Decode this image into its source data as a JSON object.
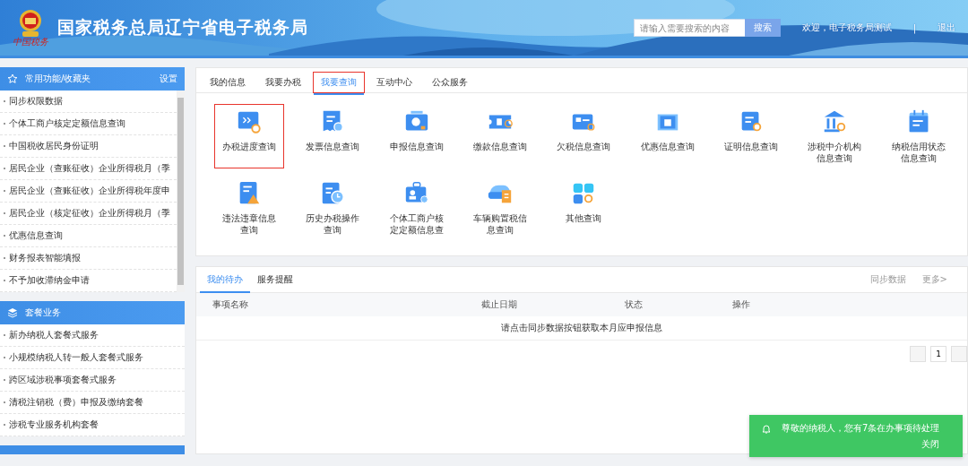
{
  "header": {
    "title": "国家税务总局辽宁省电子税务局",
    "logo_caption": "中国税务",
    "search": {
      "placeholder": "请输入需要搜索的内容",
      "button": "搜索"
    },
    "welcome": "欢迎，电子税务局测试",
    "separator": "|",
    "logout": "退出"
  },
  "sidebar": {
    "sections": [
      {
        "title": "常用功能/收藏夹",
        "action": "设置",
        "items": [
          "同步权限数据",
          "个体工商户核定定额信息查询",
          "中国税收居民身份证明",
          "居民企业（查账征收）企业所得税月（季",
          "居民企业（查账征收）企业所得税年度申",
          "居民企业（核定征收）企业所得税月（季",
          "优惠信息查询",
          "财务报表智能填报",
          "不予加收滞纳金申请"
        ]
      },
      {
        "title": "套餐业务",
        "items": [
          "新办纳税人套餐式服务",
          "小规模纳税人转一般人套餐式服务",
          "跨区域涉税事项套餐式服务",
          "清税注销税（费）申报及缴纳套餐",
          "涉税专业服务机构套餐"
        ]
      }
    ]
  },
  "main_tabs": [
    {
      "label": "我的信息",
      "selected": false,
      "highlighted": false
    },
    {
      "label": "我要办税",
      "selected": false,
      "highlighted": false
    },
    {
      "label": "我要查询",
      "selected": true,
      "highlighted": true
    },
    {
      "label": "互动中心",
      "selected": false,
      "highlighted": false
    },
    {
      "label": "公众服务",
      "selected": false,
      "highlighted": false
    }
  ],
  "tiles": [
    {
      "label": "办税进度查询",
      "highlighted": true
    },
    {
      "label": "发票信息查询",
      "highlighted": false
    },
    {
      "label": "申报信息查询",
      "highlighted": false
    },
    {
      "label": "缴款信息查询",
      "highlighted": false
    },
    {
      "label": "欠税信息查询",
      "highlighted": false
    },
    {
      "label": "优惠信息查询",
      "highlighted": false
    },
    {
      "label": "证明信息查询",
      "highlighted": false
    },
    {
      "label": "涉税中介机构信息查询",
      "highlighted": false
    },
    {
      "label": "纳税信用状态信息查询",
      "highlighted": false
    },
    {
      "label": "违法违章信息查询",
      "highlighted": false
    },
    {
      "label": "历史办税操作查询",
      "highlighted": false
    },
    {
      "label": "个体工商户核定定额信息查",
      "highlighted": false
    },
    {
      "label": "车辆购置税信息查询",
      "highlighted": false
    },
    {
      "label": "其他查询",
      "highlighted": false
    }
  ],
  "todo_panel": {
    "tabs": [
      {
        "label": "我的待办",
        "selected": true
      },
      {
        "label": "服务提醒",
        "selected": false
      }
    ],
    "actions": [
      "同步数据",
      "更多>"
    ],
    "columns": [
      "事项名称",
      "截止日期",
      "状态",
      "操作"
    ],
    "empty_message": "请点击同步数据按钮获取本月应申报信息",
    "page": "1"
  },
  "toast": {
    "message": "尊敬的纳税人，您有7条在办事项待处理",
    "close": "关闭"
  }
}
